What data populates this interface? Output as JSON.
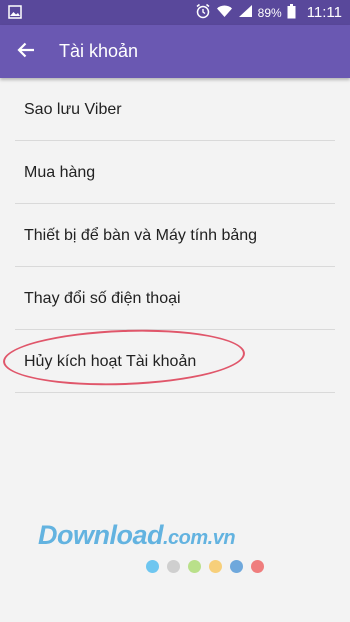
{
  "status_bar": {
    "battery_percent": "89%",
    "time": "11:11",
    "icons": [
      "image-icon",
      "alarm-icon",
      "wifi-icon",
      "signal-icon",
      "battery-icon"
    ]
  },
  "app_bar": {
    "title": "Tài khoản",
    "back_icon": "arrow-back-icon",
    "color": "#6a58b2"
  },
  "menu": {
    "items": [
      {
        "label": "Sao lưu Viber"
      },
      {
        "label": "Mua hàng"
      },
      {
        "label": "Thiết bị để bàn và Máy tính bảng"
      },
      {
        "label": "Thay đổi số điện thoại"
      },
      {
        "label": "Hủy kích hoạt Tài khoản"
      }
    ],
    "highlight_color": "#e0566a"
  },
  "watermark": {
    "brand": "Download",
    "domain": ".com.vn",
    "dot_colors": [
      "#6ec6f0",
      "#cfcfcf",
      "#b9e08a",
      "#f7cf7a",
      "#6fa8dc",
      "#ef7d7d"
    ]
  }
}
